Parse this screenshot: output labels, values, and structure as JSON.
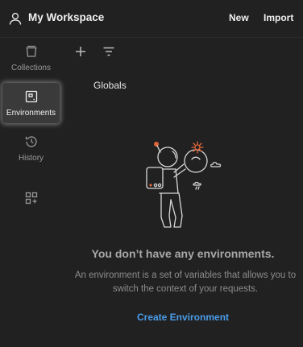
{
  "header": {
    "workspace_title": "My Workspace",
    "new_label": "New",
    "import_label": "Import"
  },
  "sidebar": {
    "items": [
      {
        "label": "Collections",
        "icon": "collections-icon",
        "active": false
      },
      {
        "label": "Environments",
        "icon": "environments-icon",
        "active": true
      },
      {
        "label": "History",
        "icon": "history-icon",
        "active": false
      },
      {
        "label": "",
        "icon": "configure-workbench-icon",
        "active": false
      }
    ]
  },
  "toolbar": {
    "add_icon": "plus-icon",
    "filter_icon": "filter-icon"
  },
  "list": {
    "globals_label": "Globals"
  },
  "empty_state": {
    "title": "You don’t have any environments.",
    "description": "An environment is a set of variables that allows you to switch the context of your requests.",
    "action_label": "Create Environment",
    "illustration": "astronaut-illustration"
  },
  "colors": {
    "background": "#212121",
    "accent_link": "#4a9dea",
    "illustration_orange": "#e0663a"
  }
}
